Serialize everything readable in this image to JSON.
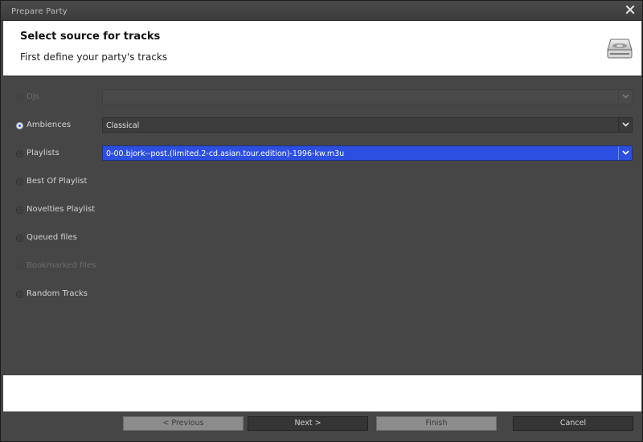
{
  "window": {
    "title": "Prepare Party"
  },
  "header": {
    "title": "Select source for tracks",
    "subtitle": "First define your party's tracks"
  },
  "options": [
    {
      "label": "DJs",
      "checked": false,
      "enabled": false,
      "combo": {
        "value": "",
        "enabled": false
      }
    },
    {
      "label": "Ambiences",
      "checked": true,
      "enabled": true,
      "combo": {
        "value": "Classical",
        "enabled": true
      }
    },
    {
      "label": "Playlists",
      "checked": false,
      "enabled": true,
      "combo": {
        "value": "0-00.bjork--post.(limited.2-cd.asian.tour.edition)-1996-kw.m3u",
        "enabled": true,
        "highlighted": true
      }
    },
    {
      "label": "Best Of Playlist",
      "checked": false,
      "enabled": true
    },
    {
      "label": "Novelties Playlist",
      "checked": false,
      "enabled": true
    },
    {
      "label": "Queued files",
      "checked": false,
      "enabled": true
    },
    {
      "label": "Bookmarked files",
      "checked": false,
      "enabled": false
    },
    {
      "label": "Random Tracks",
      "checked": false,
      "enabled": true
    }
  ],
  "buttons": {
    "previous": {
      "label": "< Previous",
      "enabled": false
    },
    "next": {
      "label": "Next >",
      "enabled": true
    },
    "finish": {
      "label": "Finish",
      "enabled": false
    },
    "cancel": {
      "label": "Cancel",
      "enabled": true
    }
  },
  "colors": {
    "background": "#464646",
    "selection": "#2d4fe0",
    "header_bg": "#ffffff"
  }
}
